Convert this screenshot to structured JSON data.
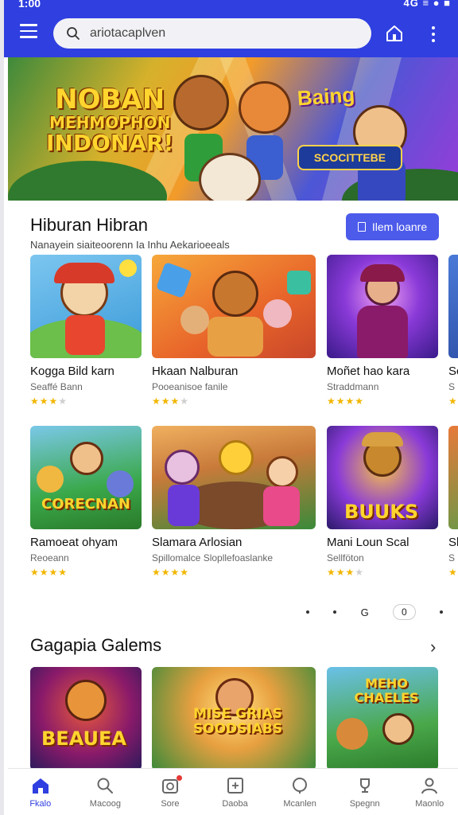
{
  "status": {
    "time": "1:00",
    "icons": "4G ≡ ● ■"
  },
  "search": {
    "placeholder": "ariotacaplven"
  },
  "banner": {
    "line1": "NOBAN",
    "line2": "MEHMOPHON",
    "line3": "INDONAR!",
    "sign": "Baing",
    "badge": "SCOCITTEBE"
  },
  "section1": {
    "title": "Hiburan Hibran",
    "subtitle": "Nanayein siaiteoorenn Ia Inhu Aekarioeeals",
    "cta_label": "Ilem loanre"
  },
  "row1": [
    {
      "name": "Kogga Bild karn",
      "sub": "Seaffé Bann",
      "stars": 3
    },
    {
      "name": "Hkaan Nalburan",
      "sub": "Pooeanisoe fanile",
      "stars": 3
    },
    {
      "name": "Moñet hao kara",
      "sub": "Straddmann",
      "stars": 4
    },
    {
      "name": "Sc",
      "sub": "S",
      "stars": 1
    }
  ],
  "row2": [
    {
      "name": "Ramoeat ohyam",
      "sub": "Reoeann",
      "stars": 4,
      "thumb_text": "CORECNAN"
    },
    {
      "name": "Slamara Arlosian",
      "sub": "Spillomalce Slopllefoaslanke",
      "stars": 4
    },
    {
      "name": "Mani Loun Scal",
      "sub": "Sellföton",
      "stars": 3,
      "thumb_text": "BUUKS"
    },
    {
      "name": "Sb",
      "sub": "S",
      "stars": 1
    }
  ],
  "pager": {
    "label": "G",
    "page": "0"
  },
  "section2": {
    "title": "Gagapia Galems",
    "chevron": "›"
  },
  "row3": [
    {
      "thumb_text": "BEAUEA"
    },
    {
      "thumb_text": "MISE GRIAS SOODSIABS"
    },
    {
      "thumb_text": "MEHO CHAELES"
    }
  ],
  "nav": [
    {
      "label": "Fkalo"
    },
    {
      "label": "Macoog"
    },
    {
      "label": "Sore"
    },
    {
      "label": "Daoba"
    },
    {
      "label": "Mcanlen"
    },
    {
      "label": "Spegnn"
    },
    {
      "label": "Maonlo"
    }
  ],
  "colors": {
    "primary": "#2f3fe0",
    "accent": "#4c5bea",
    "star": "#f2b600"
  }
}
